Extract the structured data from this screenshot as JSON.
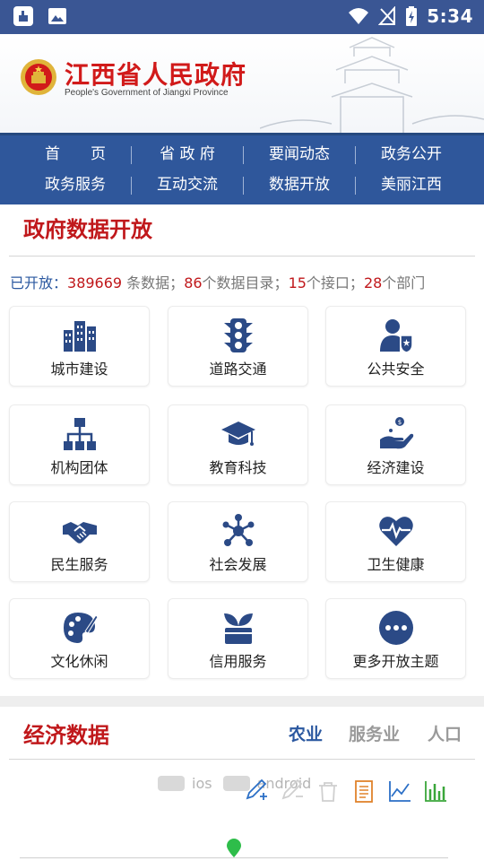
{
  "status_bar": {
    "time": "5:34"
  },
  "header": {
    "title": "江西省人民政府",
    "subtitle": "People's Government of Jiangxi Province"
  },
  "nav": {
    "row1": [
      "首　　页",
      "省 政 府",
      "要闻动态",
      "政务公开"
    ],
    "row2": [
      "政务服务",
      "互动交流",
      "数据开放",
      "美丽江西"
    ]
  },
  "open_data": {
    "title": "政府数据开放",
    "stats": {
      "label": "已开放：",
      "records": "389669",
      "records_unit": " 条数据；",
      "catalogs": "86",
      "catalogs_unit": "个数据目录；",
      "apis": "15",
      "apis_unit": "个接口；",
      "depts": "28",
      "depts_unit": "个部门"
    },
    "categories": [
      {
        "label": "城市建设",
        "icon": "city-buildings-icon"
      },
      {
        "label": "道路交通",
        "icon": "traffic-light-icon"
      },
      {
        "label": "公共安全",
        "icon": "police-shield-icon"
      },
      {
        "label": "机构团体",
        "icon": "org-chart-icon"
      },
      {
        "label": "教育科技",
        "icon": "graduation-cap-icon"
      },
      {
        "label": "经济建设",
        "icon": "hand-coin-icon"
      },
      {
        "label": "民生服务",
        "icon": "handshake-icon"
      },
      {
        "label": "社会发展",
        "icon": "network-nodes-icon"
      },
      {
        "label": "卫生健康",
        "icon": "heart-pulse-icon"
      },
      {
        "label": "文化休闲",
        "icon": "palette-icon"
      },
      {
        "label": "信用服务",
        "icon": "plant-card-icon"
      },
      {
        "label": "更多开放主题",
        "icon": "more-dots-icon"
      }
    ]
  },
  "economy": {
    "title": "经济数据",
    "tabs": [
      "农业",
      "服务业",
      "人口"
    ],
    "active_tab": "农业",
    "legend": [
      "ios",
      "android"
    ]
  },
  "colors": {
    "primary": "#2f579b",
    "accent_red": "#c0181b",
    "icon_blue": "#2b4a86"
  }
}
